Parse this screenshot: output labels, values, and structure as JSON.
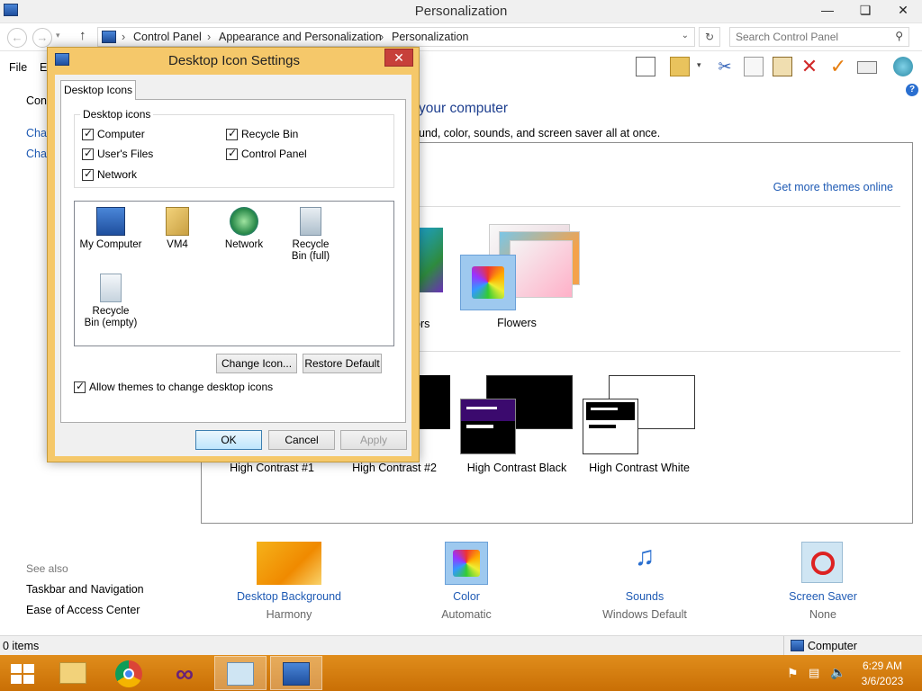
{
  "window": {
    "title": "Personalization",
    "minimize": "—",
    "maximize": "❏",
    "close": "✕"
  },
  "address": {
    "crumbs": [
      "Control Panel",
      "Appearance and Personalization",
      "Personalization"
    ],
    "search_placeholder": "Search Control Panel"
  },
  "menu": {
    "file": "File",
    "edit": "E"
  },
  "leftnav": {
    "item1": "Con",
    "item2": "Cha",
    "item3": "Cha"
  },
  "main": {
    "heading": "your computer",
    "description": "und, color, sounds, and screen saver all at once.",
    "get_more": "Get more themes online",
    "theme_partial": "ors",
    "themes_top": [
      "Flowers"
    ],
    "themes_hc": [
      "High Contrast #1",
      "High Contrast #2",
      "High Contrast Black",
      "High Contrast White"
    ]
  },
  "see_also": {
    "header": "See also",
    "items": [
      "Taskbar and Navigation",
      "Ease of Access Center"
    ]
  },
  "bottom": [
    {
      "label": "Desktop Background",
      "sub": "Harmony"
    },
    {
      "label": "Color",
      "sub": "Automatic"
    },
    {
      "label": "Sounds",
      "sub": "Windows Default"
    },
    {
      "label": "Screen Saver",
      "sub": "None"
    }
  ],
  "status": {
    "left": "0 items",
    "right": "Computer"
  },
  "tray": {
    "time": "6:29 AM",
    "date": "3/6/2023"
  },
  "dialog": {
    "title": "Desktop Icon Settings",
    "close": "✕",
    "tab": "Desktop Icons",
    "group_label": "Desktop icons",
    "checks": [
      "Computer",
      "Recycle Bin",
      "User's Files",
      "Control Panel",
      "Network"
    ],
    "icons": [
      {
        "label": "My Computer"
      },
      {
        "label": "VM4"
      },
      {
        "label": "Network"
      },
      {
        "label": "Recycle Bin (full)"
      },
      {
        "label": "Recycle Bin (empty)"
      }
    ],
    "change_icon": "Change Icon...",
    "restore_default": "Restore Default",
    "allow_themes": "Allow themes to change desktop icons",
    "ok": "OK",
    "cancel": "Cancel",
    "apply": "Apply"
  },
  "colors": {
    "accent": "#1e5ab4",
    "taskbar": "#d97f10",
    "dialog_frame": "#f5c86a"
  }
}
